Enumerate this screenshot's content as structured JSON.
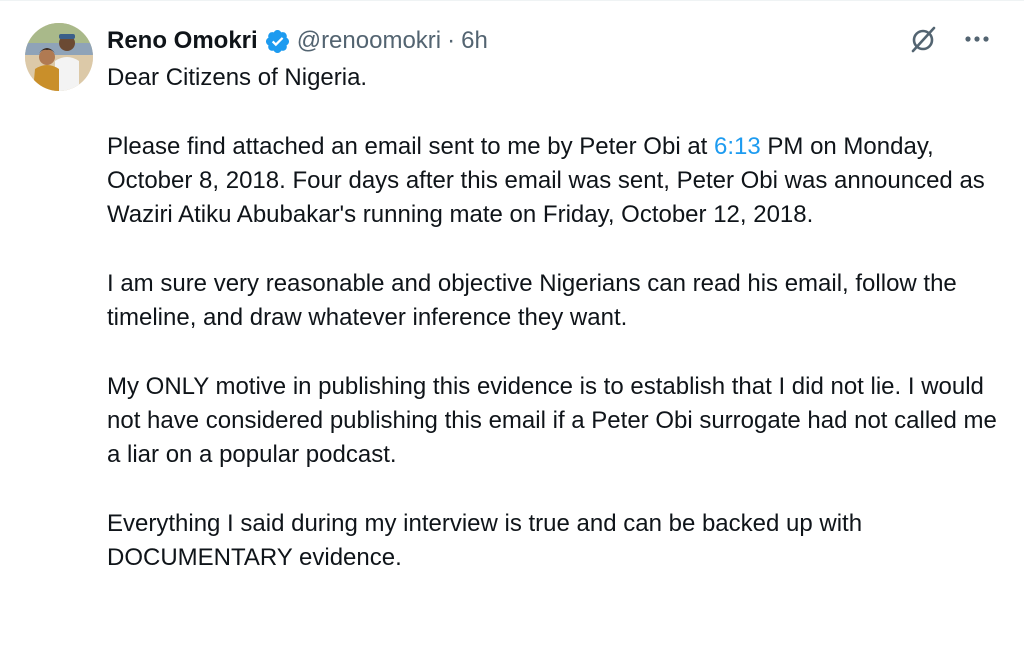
{
  "author": {
    "name": "Reno Omokri",
    "handle": "@renoomokri",
    "separator": "·",
    "time": "6h",
    "verified": true
  },
  "icons": {
    "avatar": "avatar-photo",
    "verified": "verified-badge-icon",
    "grok": "grok-icon",
    "more": "more-icon"
  },
  "colors": {
    "link": "#1d9bf0",
    "verified": "#1d9bf0",
    "secondary_text": "#536471",
    "text": "#0f1419"
  },
  "tweet": {
    "p1": "Dear Citizens of Nigeria.",
    "p2_pre": "Please find attached an email sent to me by Peter Obi at ",
    "p2_link": "6:13",
    "p2_post": " PM on Monday, October 8, 2018. Four days after this email was sent, Peter Obi was announced as Waziri Atiku Abubakar's running mate on Friday, October 12, 2018.",
    "p3": "I am sure very reasonable and objective Nigerians can read his email, follow the timeline, and draw whatever inference they want.",
    "p4": "My ONLY motive in publishing this evidence is to establish that I did not lie. I would not have considered publishing this email if a Peter Obi surrogate had not called me a liar on a popular podcast.",
    "p5": "Everything I said during my interview is true and can be backed up with DOCUMENTARY evidence."
  }
}
